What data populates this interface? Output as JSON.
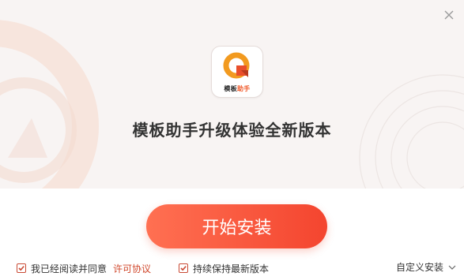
{
  "window": {
    "close_icon": "close-icon",
    "colors": {
      "accent": "#f4452f",
      "hero_bg": "#f8f4f3",
      "link": "#d0472b"
    }
  },
  "logo": {
    "text_part1": "模板",
    "text_part2": "助手"
  },
  "headline": "模板助手升级体验全新版本",
  "install_button": {
    "label": "开始安装"
  },
  "agreement": {
    "checked": true,
    "label": "我已经阅读并同意",
    "link": "许可协议"
  },
  "keep_latest": {
    "checked": true,
    "label": "持续保持最新版本"
  },
  "custom_install": {
    "label": "自定义安装",
    "icon": "chevron-down-icon"
  }
}
